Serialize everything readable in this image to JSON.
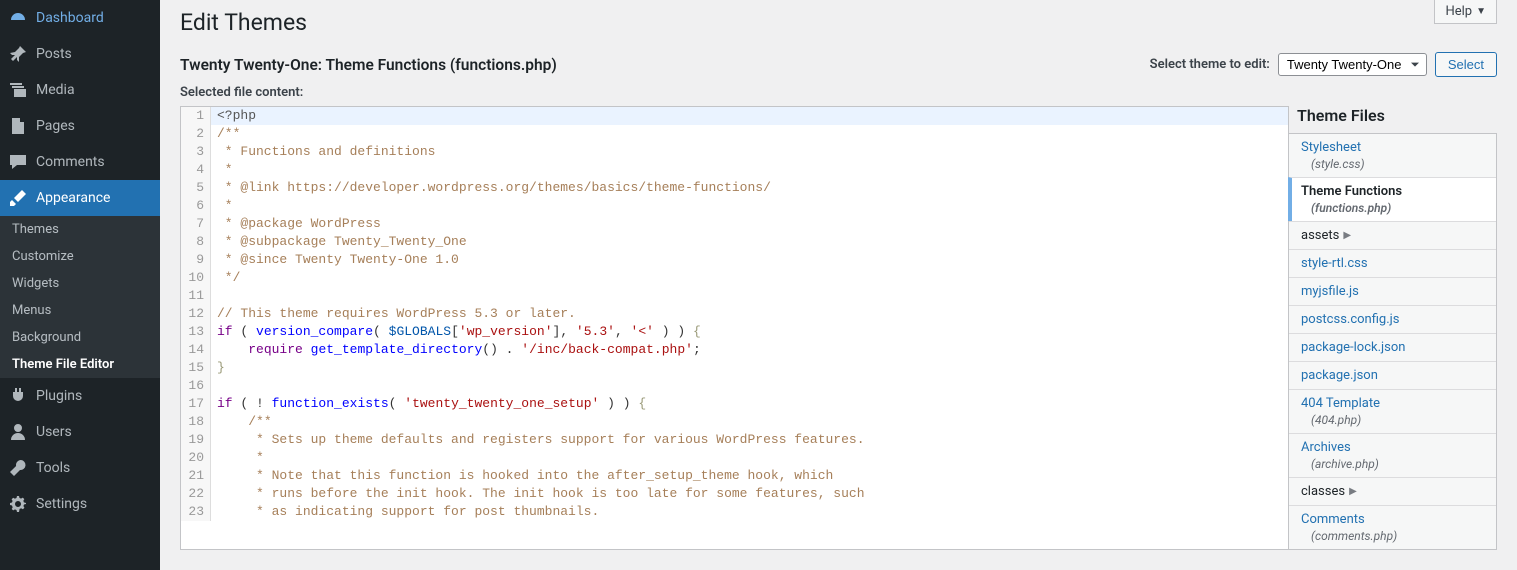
{
  "header": {
    "help_label": "Help",
    "page_title": "Edit Themes",
    "file_title": "Twenty Twenty-One: Theme Functions (functions.php)",
    "select_theme_label": "Select theme to edit:",
    "selected_theme": "Twenty Twenty-One",
    "select_button": "Select",
    "selected_file_label": "Selected file content:"
  },
  "sidebar": {
    "items": [
      {
        "icon": "dashboard-icon",
        "label": "Dashboard"
      },
      {
        "icon": "pin-icon",
        "label": "Posts"
      },
      {
        "icon": "media-icon",
        "label": "Media"
      },
      {
        "icon": "page-icon",
        "label": "Pages"
      },
      {
        "icon": "comment-icon",
        "label": "Comments"
      },
      {
        "icon": "brush-icon",
        "label": "Appearance",
        "current": true
      },
      {
        "icon": "plugin-icon",
        "label": "Plugins"
      },
      {
        "icon": "user-icon",
        "label": "Users"
      },
      {
        "icon": "wrench-icon",
        "label": "Tools"
      },
      {
        "icon": "gear-icon",
        "label": "Settings"
      }
    ],
    "submenu": [
      "Themes",
      "Customize",
      "Widgets",
      "Menus",
      "Background",
      "Theme File Editor"
    ],
    "submenu_current_index": 5
  },
  "code": {
    "lines": [
      {
        "n": 1,
        "segs": [
          [
            "cm-meta",
            "<?php"
          ]
        ],
        "active": true
      },
      {
        "n": 2,
        "segs": [
          [
            "cm-comment",
            "/**"
          ]
        ]
      },
      {
        "n": 3,
        "segs": [
          [
            "cm-comment",
            " * Functions and definitions"
          ]
        ]
      },
      {
        "n": 4,
        "segs": [
          [
            "cm-comment",
            " *"
          ]
        ]
      },
      {
        "n": 5,
        "segs": [
          [
            "cm-comment",
            " * @link https://developer.wordpress.org/themes/basics/theme-functions/"
          ]
        ]
      },
      {
        "n": 6,
        "segs": [
          [
            "cm-comment",
            " *"
          ]
        ]
      },
      {
        "n": 7,
        "segs": [
          [
            "cm-comment",
            " * @package WordPress"
          ]
        ]
      },
      {
        "n": 8,
        "segs": [
          [
            "cm-comment",
            " * @subpackage Twenty_Twenty_One"
          ]
        ]
      },
      {
        "n": 9,
        "segs": [
          [
            "cm-comment",
            " * @since Twenty Twenty-One 1.0"
          ]
        ]
      },
      {
        "n": 10,
        "segs": [
          [
            "cm-comment",
            " */"
          ]
        ]
      },
      {
        "n": 11,
        "segs": []
      },
      {
        "n": 12,
        "segs": [
          [
            "cm-comment",
            "// This theme requires WordPress 5.3 or later."
          ]
        ]
      },
      {
        "n": 13,
        "segs": [
          [
            "cm-keyword",
            "if"
          ],
          [
            "cm-punct",
            " ( "
          ],
          [
            "cm-def",
            "version_compare"
          ],
          [
            "cm-punct",
            "( "
          ],
          [
            "cm-var2",
            "$GLOBALS"
          ],
          [
            "cm-punct",
            "["
          ],
          [
            "cm-string",
            "'wp_version'"
          ],
          [
            "cm-punct",
            "], "
          ],
          [
            "cm-string",
            "'5.3'"
          ],
          [
            "cm-punct",
            ", "
          ],
          [
            "cm-string",
            "'<'"
          ],
          [
            "cm-punct",
            " ) ) "
          ],
          [
            "cm-brace",
            "{"
          ]
        ]
      },
      {
        "n": 14,
        "segs": [
          [
            "cm-punct",
            "    "
          ],
          [
            "cm-keyword",
            "require"
          ],
          [
            "cm-punct",
            " "
          ],
          [
            "cm-def",
            "get_template_directory"
          ],
          [
            "cm-punct",
            "() . "
          ],
          [
            "cm-string",
            "'/inc/back-compat.php'"
          ],
          [
            "cm-punct",
            ";"
          ]
        ]
      },
      {
        "n": 15,
        "segs": [
          [
            "cm-brace",
            "}"
          ]
        ]
      },
      {
        "n": 16,
        "segs": []
      },
      {
        "n": 17,
        "segs": [
          [
            "cm-keyword",
            "if"
          ],
          [
            "cm-punct",
            " ( ! "
          ],
          [
            "cm-def",
            "function_exists"
          ],
          [
            "cm-punct",
            "( "
          ],
          [
            "cm-string",
            "'twenty_twenty_one_setup'"
          ],
          [
            "cm-punct",
            " ) ) "
          ],
          [
            "cm-brace",
            "{"
          ]
        ]
      },
      {
        "n": 18,
        "segs": [
          [
            "cm-punct",
            "    "
          ],
          [
            "cm-comment",
            "/**"
          ]
        ]
      },
      {
        "n": 19,
        "segs": [
          [
            "cm-comment",
            "     * Sets up theme defaults and registers support for various WordPress features."
          ]
        ]
      },
      {
        "n": 20,
        "segs": [
          [
            "cm-comment",
            "     *"
          ]
        ]
      },
      {
        "n": 21,
        "segs": [
          [
            "cm-comment",
            "     * Note that this function is hooked into the after_setup_theme hook, which"
          ]
        ]
      },
      {
        "n": 22,
        "segs": [
          [
            "cm-comment",
            "     * runs before the init hook. The init hook is too late for some features, such"
          ]
        ]
      },
      {
        "n": 23,
        "segs": [
          [
            "cm-comment",
            "     * as indicating support for post thumbnails."
          ]
        ]
      }
    ]
  },
  "files": {
    "title": "Theme Files",
    "items": [
      {
        "label": "Stylesheet",
        "sub": "(style.css)"
      },
      {
        "label": "Theme Functions",
        "sub": "(functions.php)",
        "active": true
      },
      {
        "label": "assets",
        "folder": true
      },
      {
        "label": "style-rtl.css"
      },
      {
        "label": "myjsfile.js"
      },
      {
        "label": "postcss.config.js"
      },
      {
        "label": "package-lock.json"
      },
      {
        "label": "package.json"
      },
      {
        "label": "404 Template",
        "sub": "(404.php)"
      },
      {
        "label": "Archives",
        "sub": "(archive.php)"
      },
      {
        "label": "classes",
        "folder": true
      },
      {
        "label": "Comments",
        "sub": "(comments.php)"
      }
    ]
  }
}
